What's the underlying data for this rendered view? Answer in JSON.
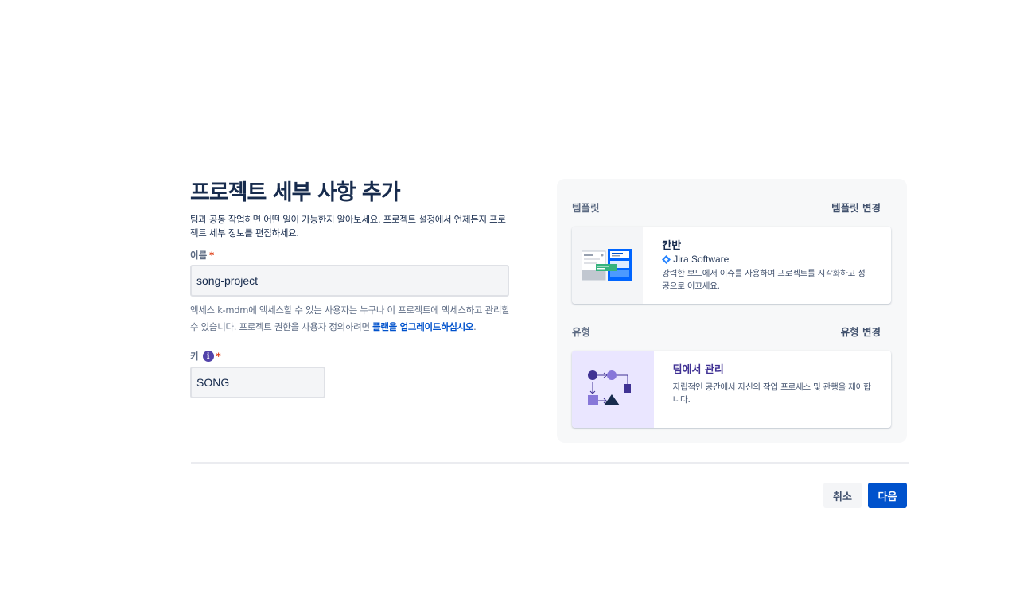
{
  "form": {
    "title": "프로젝트 세부 사항 추가",
    "subtitle": "팀과 공동 작업하면 어떤 일이 가능한지 알아보세요. 프로젝트 설정에서 언제든지 프로젝트 세부 정보를 편집하세요.",
    "name_label": "이름",
    "required_mark": "*",
    "name_value": "song-project",
    "access_help_text": "액세스 k-mdm에 액세스할 수 있는 사용자는 누구나 이 프로젝트에 액세스하고 관리할 수 있습니다. 프로젝트 권한을 사용자 정의하려면 ",
    "access_help_link": "플랜을 업그레이드하십시오",
    "access_help_end": ".",
    "key_label": "키",
    "key_info_icon": "i",
    "key_value": "SONG"
  },
  "template_section": {
    "label": "템플릿",
    "change_label": "템플릿 변경",
    "card": {
      "title": "칸반",
      "product": "Jira Software",
      "description": "강력한 보드에서 이슈를 사용하여 프로젝트를 시각화하고 성공으로 이끄세요.",
      "icon": "kanban-board-illustration",
      "thumb_bg": "#f4f5f7"
    }
  },
  "type_section": {
    "label": "유형",
    "change_label": "유형 변경",
    "card": {
      "title": "팀에서 관리",
      "description": "자립적인 공간에서 자신의 작업 프로세스 및 관행을 제어합니다.",
      "icon": "team-managed-illustration",
      "thumb_bg": "#eae6ff"
    }
  },
  "footer": {
    "cancel_label": "취소",
    "next_label": "다음"
  },
  "colors": {
    "primary": "#0052cc",
    "heading": "#172b4d",
    "required": "#de350b",
    "accent_purple": "#5243aa"
  }
}
